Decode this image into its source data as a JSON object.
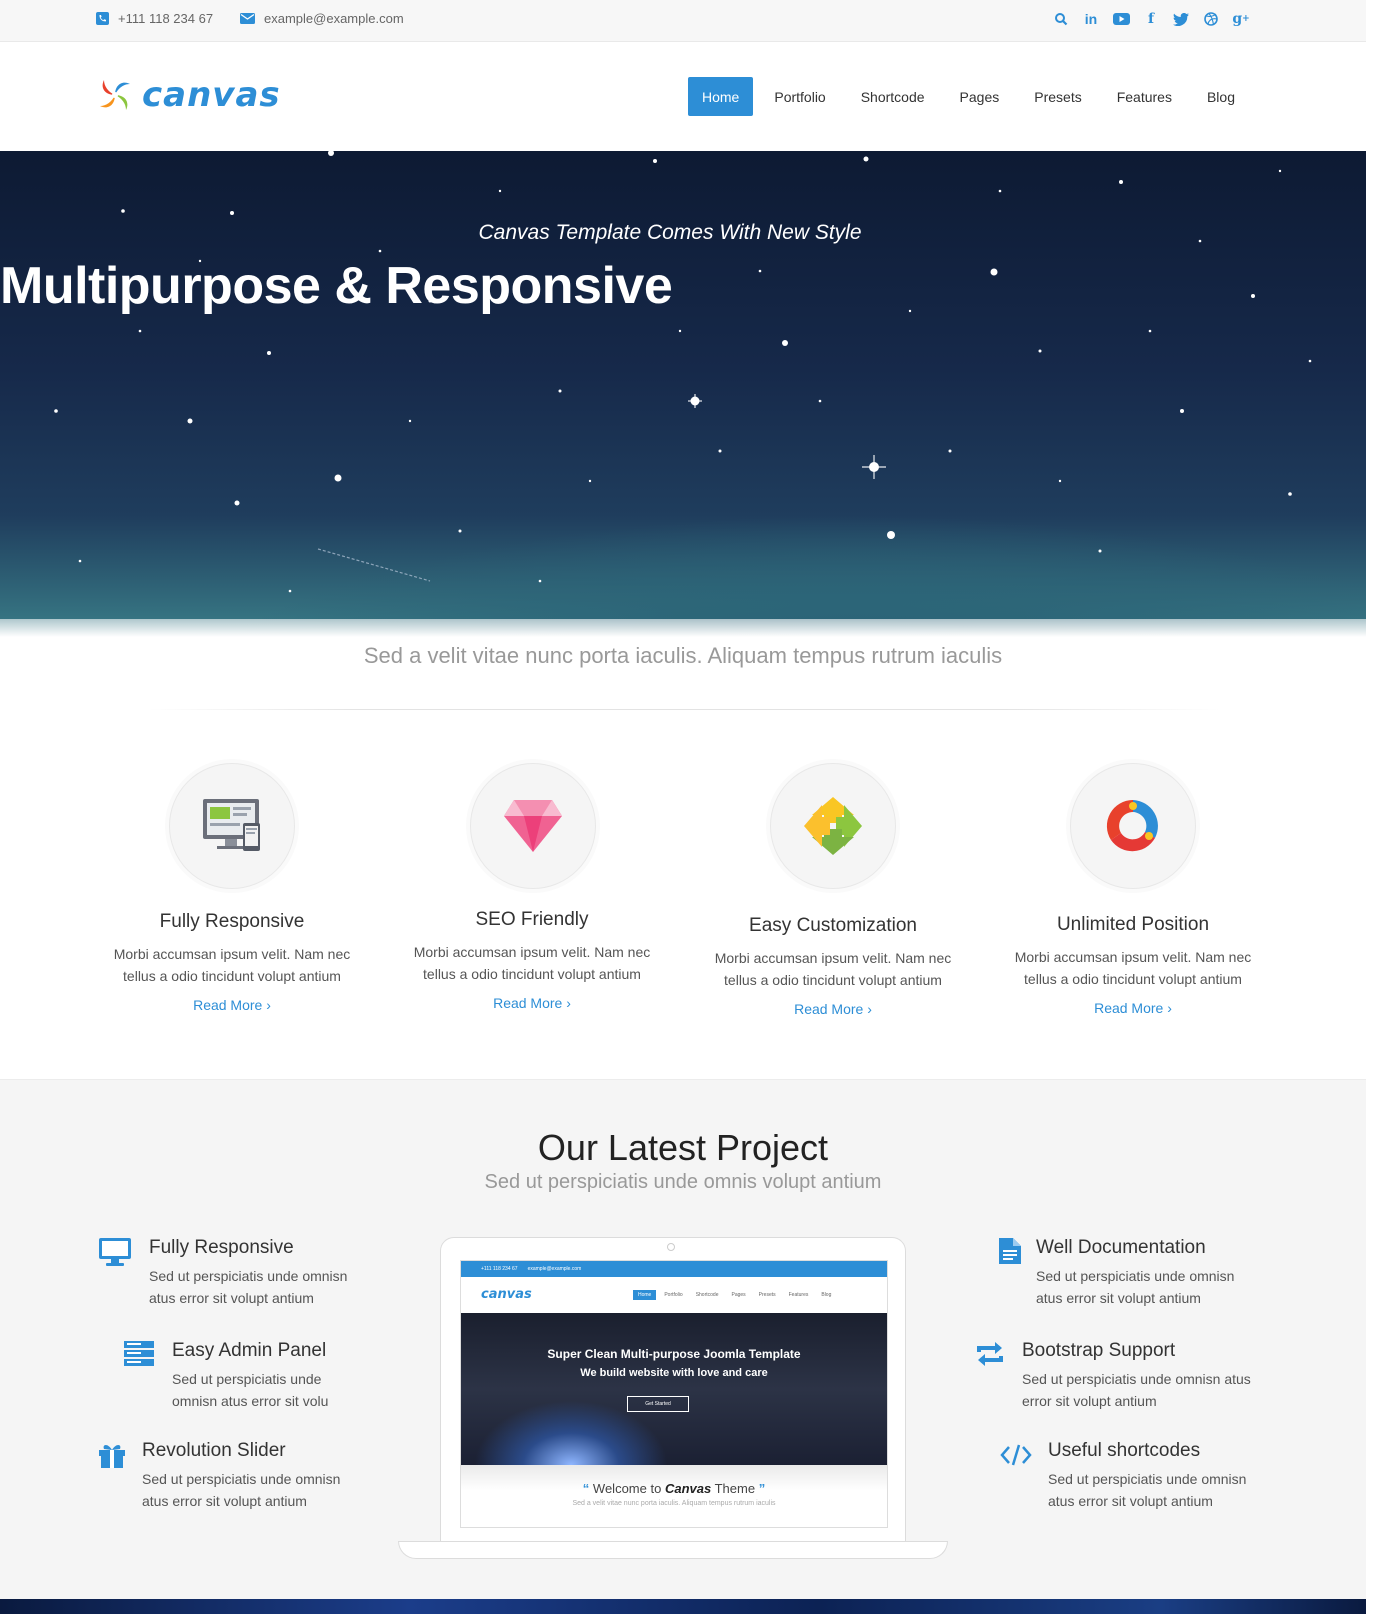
{
  "topbar": {
    "phone": "+111 118 234 67",
    "email": "example@example.com",
    "social_icons": [
      "search-icon",
      "linkedin-icon",
      "youtube-icon",
      "facebook-icon",
      "twitter-icon",
      "dribbble-icon",
      "google-plus-icon"
    ]
  },
  "header": {
    "logo_text": "canvas",
    "nav": [
      {
        "label": "Home",
        "active": true
      },
      {
        "label": "Portfolio"
      },
      {
        "label": "Shortcode"
      },
      {
        "label": "Pages"
      },
      {
        "label": "Presets"
      },
      {
        "label": "Features"
      },
      {
        "label": "Blog"
      }
    ]
  },
  "hero": {
    "subtitle": "Canvas Template Comes With New Style",
    "title": "Multipurpose & Responsive"
  },
  "tagline": "Sed a velit vitae nunc porta iaculis. Aliquam tempus rutrum iaculis",
  "features": [
    {
      "title": "Fully Responsive",
      "line1": "Morbi accumsan ipsum velit. Nam nec",
      "line2": "tellus a odio tincidunt volupt antium",
      "more": "Read More",
      "icon": "devices-icon"
    },
    {
      "title": "SEO Friendly",
      "line1": "Morbi accumsan ipsum velit. Nam nec",
      "line2": "tellus a odio tincidunt volupt antium",
      "more": "Read More",
      "icon": "diamond-icon"
    },
    {
      "title": "Easy Customization",
      "line1": "Morbi accumsan ipsum velit. Nam nec",
      "line2": "tellus a odio tincidunt volupt antium",
      "more": "Read More",
      "icon": "recycle-arrows-icon"
    },
    {
      "title": "Unlimited Position",
      "line1": "Morbi accumsan ipsum velit. Nam nec",
      "line2": "tellus a odio tincidunt volupt antium",
      "more": "Read More",
      "icon": "ring-icon"
    }
  ],
  "latest": {
    "title": "Our Latest Project",
    "subtitle": "Sed ut perspiciatis unde omnis volupt antium",
    "left": [
      {
        "title": "Fully Responsive",
        "line1": "Sed ut perspiciatis unde omnisn",
        "line2": "atus error sit volupt antium",
        "icon": "monitor-icon"
      },
      {
        "title": "Easy Admin Panel",
        "line1": "Sed ut perspiciatis unde",
        "line2": "omnisn atus error sit volu",
        "icon": "server-icon"
      },
      {
        "title": "Revolution Slider",
        "line1": "Sed ut perspiciatis unde omnisn",
        "line2": "atus error sit volupt antium",
        "icon": "gift-icon"
      }
    ],
    "right": [
      {
        "title": "Well Documentation",
        "line1": "Sed ut perspiciatis unde omnisn",
        "line2": "atus error sit volupt antium",
        "icon": "document-icon"
      },
      {
        "title": "Bootstrap Support",
        "line1": "Sed ut perspiciatis unde omnisn atus",
        "line2": "error sit volupt antium",
        "icon": "retweet-icon"
      },
      {
        "title": "Useful shortcodes",
        "line1": "Sed ut perspiciatis unde omnisn",
        "line2": "atus error sit volupt antium",
        "icon": "code-icon"
      }
    ],
    "screen": {
      "top_phone": "+111 118 234 67",
      "top_email": "example@example.com",
      "logo": "canvas",
      "nav": [
        "Home",
        "Portfolio",
        "Shortcode",
        "Pages",
        "Presets",
        "Features",
        "Blog"
      ],
      "hero_line1": "Super Clean Multi-purpose Joomla Template",
      "hero_line2": "We build website with love and care",
      "button": "Get Started",
      "welcome_pre": "Welcome to",
      "welcome_brand": "Canvas",
      "welcome_post": "Theme",
      "small": "Sed a velit vitae nunc porta iaculis. Aliquam tempus rutrum iaculis"
    }
  },
  "colors": {
    "accent": "#2d8ed6",
    "text": "#333333",
    "muted": "#999999"
  }
}
